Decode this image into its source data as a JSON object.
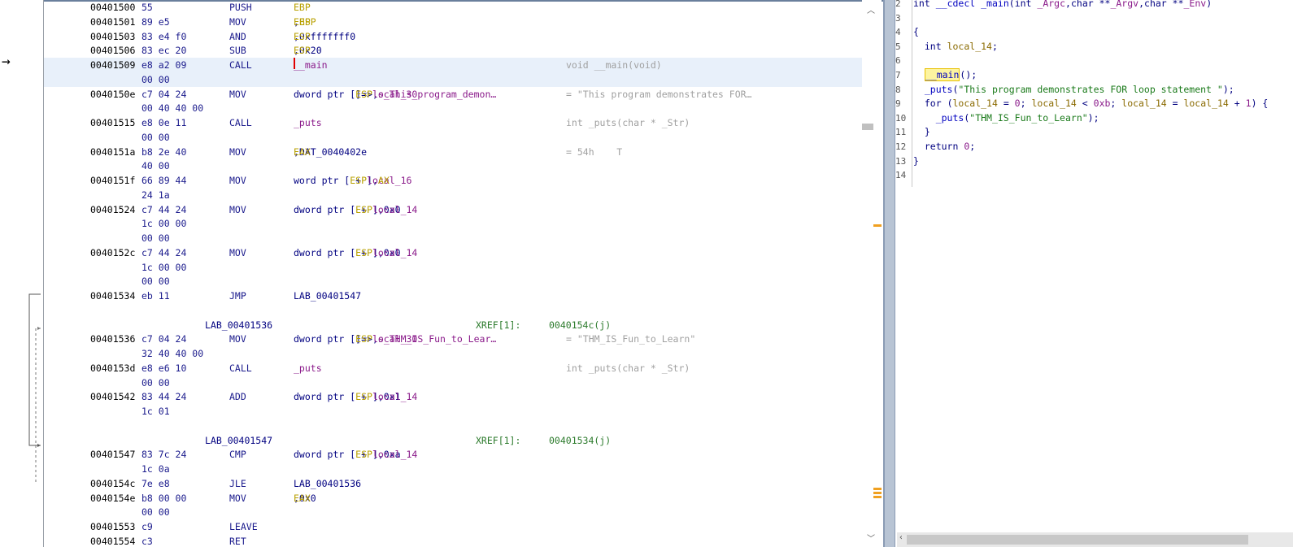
{
  "listing": {
    "rows": [
      {
        "type": "ins",
        "addr": "00401500",
        "bytes": "55",
        "mnem": "PUSH",
        "ops_html": "<span class=\"reg\">EBP</span>"
      },
      {
        "type": "ins",
        "addr": "00401501",
        "bytes": "89 e5",
        "mnem": "MOV",
        "ops_html": "<span class=\"reg\">EBP</span>,<span class=\"reg\">ESP</span>"
      },
      {
        "type": "ins",
        "addr": "00401503",
        "bytes": "83 e4 f0",
        "mnem": "AND",
        "ops_html": "<span class=\"reg\">ESP</span>,0xfffffff0"
      },
      {
        "type": "ins",
        "addr": "00401506",
        "bytes": "83 ec 20",
        "mnem": "SUB",
        "ops_html": "<span class=\"reg\">ESP</span>,0x20"
      },
      {
        "type": "ins",
        "addr": "00401509",
        "bytes": "e8 a2 09",
        "mnem": "CALL",
        "ops_html": "<span class=\"loc\">__main</span><span class=\"caret\"></span>",
        "comment": "void __main(void)",
        "current": true
      },
      {
        "type": "cont",
        "bytes": "00 00"
      },
      {
        "type": "ins",
        "addr": "0040150e",
        "bytes": "c7 04 24",
        "mnem": "MOV",
        "ops_html": "dword ptr [<span class=\"reg\">ESP</span>]=&gt;<span class=\"loc\">local_30</span>,<span class=\"loc\">s_This_program_demon…</span>",
        "comment": "= \"This program demonstrates FOR…"
      },
      {
        "type": "cont",
        "bytes": "00 40 40 00"
      },
      {
        "type": "ins",
        "addr": "00401515",
        "bytes": "e8 0e 11",
        "mnem": "CALL",
        "ops_html": "<span class=\"loc\">_puts</span>",
        "comment": "int _puts(char * _Str)"
      },
      {
        "type": "cont",
        "bytes": "00 00"
      },
      {
        "type": "ins",
        "addr": "0040151a",
        "bytes": "b8 2e 40",
        "mnem": "MOV",
        "ops_html": "<span class=\"reg\">EAX</span>,DAT_0040402e",
        "comment": "= 54h    T"
      },
      {
        "type": "cont",
        "bytes": "40 00"
      },
      {
        "type": "ins",
        "addr": "0040151f",
        "bytes": "66 89 44",
        "mnem": "MOV",
        "ops_html": "word ptr [<span class=\"reg\">ESP</span> + <span class=\"loc\">local_16</span>],<span class=\"reg\">AX</span>"
      },
      {
        "type": "cont",
        "bytes": "24 1a"
      },
      {
        "type": "ins",
        "addr": "00401524",
        "bytes": "c7 44 24",
        "mnem": "MOV",
        "ops_html": "dword ptr [<span class=\"reg\">ESP</span> + <span class=\"loc\">local_14</span>],0x0"
      },
      {
        "type": "cont",
        "bytes": "1c 00 00"
      },
      {
        "type": "cont",
        "bytes": "00 00"
      },
      {
        "type": "ins",
        "addr": "0040152c",
        "bytes": "c7 44 24",
        "mnem": "MOV",
        "ops_html": "dword ptr [<span class=\"reg\">ESP</span> + <span class=\"loc\">local_14</span>],0x0"
      },
      {
        "type": "cont",
        "bytes": "1c 00 00"
      },
      {
        "type": "cont",
        "bytes": "00 00"
      },
      {
        "type": "ins",
        "addr": "00401534",
        "bytes": "eb 11",
        "mnem": "JMP",
        "ops_html": "LAB_00401547"
      },
      {
        "type": "blank"
      },
      {
        "type": "label",
        "label": "LAB_00401536",
        "xref": "XREF[1]:",
        "xrefaddr": "0040154c(j)"
      },
      {
        "type": "ins",
        "addr": "00401536",
        "bytes": "c7 04 24",
        "mnem": "MOV",
        "ops_html": "dword ptr [<span class=\"reg\">ESP</span>]=&gt;<span class=\"loc\">local_30</span>,<span class=\"loc\">s_THM_IS_Fun_to_Lear…</span>",
        "comment": "= \"THM_IS_Fun_to_Learn\""
      },
      {
        "type": "cont",
        "bytes": "32 40 40 00"
      },
      {
        "type": "ins",
        "addr": "0040153d",
        "bytes": "e8 e6 10",
        "mnem": "CALL",
        "ops_html": "<span class=\"loc\">_puts</span>",
        "comment": "int _puts(char * _Str)"
      },
      {
        "type": "cont",
        "bytes": "00 00"
      },
      {
        "type": "ins",
        "addr": "00401542",
        "bytes": "83 44 24",
        "mnem": "ADD",
        "ops_html": "dword ptr [<span class=\"reg\">ESP</span> + <span class=\"loc\">local_14</span>],0x1"
      },
      {
        "type": "cont",
        "bytes": "1c 01"
      },
      {
        "type": "blank"
      },
      {
        "type": "label",
        "label": "LAB_00401547",
        "xref": "XREF[1]:",
        "xrefaddr": "00401534(j)"
      },
      {
        "type": "ins",
        "addr": "00401547",
        "bytes": "83 7c 24",
        "mnem": "CMP",
        "ops_html": "dword ptr [<span class=\"reg\">ESP</span> + <span class=\"loc\">local_14</span>],0xa"
      },
      {
        "type": "cont",
        "bytes": "1c 0a"
      },
      {
        "type": "ins",
        "addr": "0040154c",
        "bytes": "7e e8",
        "mnem": "JLE",
        "ops_html": "LAB_00401536"
      },
      {
        "type": "ins",
        "addr": "0040154e",
        "bytes": "b8 00 00",
        "mnem": "MOV",
        "ops_html": "<span class=\"reg\">EAX</span>,0x0"
      },
      {
        "type": "cont",
        "bytes": "00 00"
      },
      {
        "type": "ins",
        "addr": "00401553",
        "bytes": "c9",
        "mnem": "LEAVE",
        "ops_html": ""
      },
      {
        "type": "ins",
        "addr": "00401554",
        "bytes": "c3",
        "mnem": "RET",
        "ops_html": ""
      }
    ]
  },
  "decompiler": {
    "lines": [
      {
        "n": "2",
        "html": "<span class=\"kw\">int</span> <span class=\"fn\">__cdecl</span> <span class=\"fn\">_main</span>(<span class=\"kw\">int</span> <span class=\"num\">_Argc</span>,<span class=\"kw\">char</span> **<span class=\"num\">_Argv</span>,<span class=\"kw\">char</span> **<span class=\"num\">_Env</span>)"
      },
      {
        "n": "3",
        "html": ""
      },
      {
        "n": "4",
        "html": "{"
      },
      {
        "n": "5",
        "html": "  <span class=\"kw\">int</span> <span class=\"var\">local_14</span>;"
      },
      {
        "n": "6",
        "html": ""
      },
      {
        "n": "7",
        "html": "  <span class=\"hl\"><span class=\"fn\">__main</span></span>();"
      },
      {
        "n": "8",
        "html": "  <span class=\"fn\">_puts</span>(<span class=\"str\">\"This program demonstrates FOR loop statement \"</span>);"
      },
      {
        "n": "9",
        "html": "  <span class=\"kw\">for</span> (<span class=\"var\">local_14</span> = <span class=\"num\">0</span>; <span class=\"var\">local_14</span> &lt; <span class=\"num\">0xb</span>; <span class=\"var\">local_14</span> = <span class=\"var\">local_14</span> + <span class=\"num\">1</span>) {"
      },
      {
        "n": "10",
        "html": "    <span class=\"fn\">_puts</span>(<span class=\"str\">\"THM_IS_Fun_to_Learn\"</span>);"
      },
      {
        "n": "11",
        "html": "  }"
      },
      {
        "n": "12",
        "html": "  <span class=\"kw\">return</span> <span class=\"num\">0</span>;"
      },
      {
        "n": "13",
        "html": "}"
      },
      {
        "n": "14",
        "html": ""
      }
    ]
  },
  "colors": {
    "current_row": "#e8f0fa",
    "splitter": "#b8c4d4",
    "marker": "#f0a020"
  },
  "icons": {
    "cursor": "right-arrow-icon",
    "scroll_up": "chevron-up-icon",
    "scroll_down": "chevron-down-icon"
  }
}
